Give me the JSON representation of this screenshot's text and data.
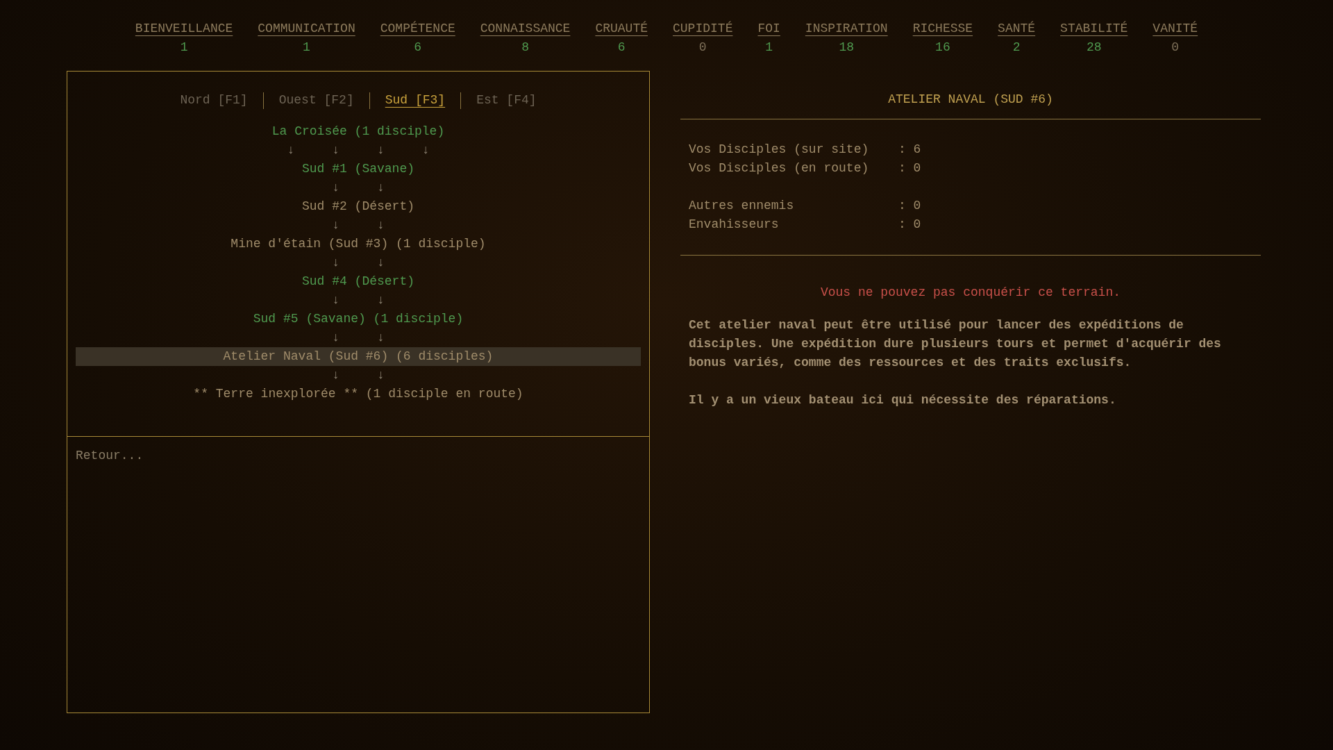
{
  "stats": [
    {
      "label": "BIENVEILLANCE",
      "value": "1",
      "color": "#4f9a4f"
    },
    {
      "label": "COMMUNICATION",
      "value": "1",
      "color": "#4f9a4f"
    },
    {
      "label": "COMPÉTENCE",
      "value": "6",
      "color": "#4f9a4f"
    },
    {
      "label": "CONNAISSANCE",
      "value": "8",
      "color": "#4f9a4f"
    },
    {
      "label": "CRUAUTÉ",
      "value": "6",
      "color": "#4f9a4f"
    },
    {
      "label": "CUPIDITÉ",
      "value": "0",
      "color": "#7d6f58"
    },
    {
      "label": "FOI",
      "value": "1",
      "color": "#4f9a4f"
    },
    {
      "label": "INSPIRATION",
      "value": "18",
      "color": "#4f9a4f"
    },
    {
      "label": "RICHESSE",
      "value": "16",
      "color": "#4f9a4f"
    },
    {
      "label": "SANTÉ",
      "value": "2",
      "color": "#4f9a4f"
    },
    {
      "label": "STABILITÉ",
      "value": "28",
      "color": "#4f9a4f"
    },
    {
      "label": "VANITÉ",
      "value": "0",
      "color": "#7d6f58"
    }
  ],
  "tabs": [
    {
      "label": "Nord [F1]",
      "selected": false
    },
    {
      "label": "Ouest [F2]",
      "selected": false
    },
    {
      "label": "Sud [F3]",
      "selected": true
    },
    {
      "label": "Est [F4]",
      "selected": false
    }
  ],
  "map": [
    {
      "kind": "node",
      "label": "La Croisée (1 disciple)",
      "color": "#4f9a4f",
      "selected": false
    },
    {
      "kind": "arrows",
      "label": "↓     ↓     ↓     ↓"
    },
    {
      "kind": "node",
      "label": "Sud #1 (Savane)",
      "color": "#4f9a4f",
      "selected": false
    },
    {
      "kind": "arrows",
      "label": "↓     ↓"
    },
    {
      "kind": "node",
      "label": "Sud #2 (Désert)",
      "color": "#a08c6a",
      "selected": false
    },
    {
      "kind": "arrows",
      "label": "↓     ↓"
    },
    {
      "kind": "node",
      "label": "Mine d'étain (Sud #3) (1 disciple)",
      "color": "#a08c6a",
      "selected": false
    },
    {
      "kind": "arrows",
      "label": "↓     ↓"
    },
    {
      "kind": "node",
      "label": "Sud #4 (Désert)",
      "color": "#4f9a4f",
      "selected": false
    },
    {
      "kind": "arrows",
      "label": "↓     ↓"
    },
    {
      "kind": "node",
      "label": "Sud #5 (Savane) (1 disciple)",
      "color": "#4f9a4f",
      "selected": false
    },
    {
      "kind": "arrows",
      "label": "↓     ↓"
    },
    {
      "kind": "node",
      "label": "Atelier Naval (Sud #6) (6 disciples)",
      "color": "#a08c6a",
      "selected": true
    },
    {
      "kind": "arrows",
      "label": "↓     ↓"
    },
    {
      "kind": "node",
      "label": "** Terre inexplorée ** (1 disciple en route)",
      "color": "#a08c6a",
      "selected": false
    }
  ],
  "back_link": "Retour...",
  "detail": {
    "title": "ATELIER NAVAL (SUD #6)",
    "info_groups": [
      [
        {
          "label": "Vos Disciples (sur site)",
          "value": ": 6"
        },
        {
          "label": "Vos Disciples (en route)",
          "value": ": 0"
        }
      ],
      [
        {
          "label": "Autres ennemis",
          "value": ": 0"
        },
        {
          "label": "Envahisseurs",
          "value": ": 0"
        }
      ]
    ],
    "warning": "Vous ne pouvez pas conquérir ce terrain.",
    "paragraphs": [
      "Cet atelier naval peut être utilisé pour lancer des expéditions de disciples. Une expédition dure plusieurs tours et permet d'acquérir des bonus variés, comme des ressources et des traits exclusifs.",
      "Il y a un vieux bateau ici qui nécessite des réparations."
    ]
  }
}
